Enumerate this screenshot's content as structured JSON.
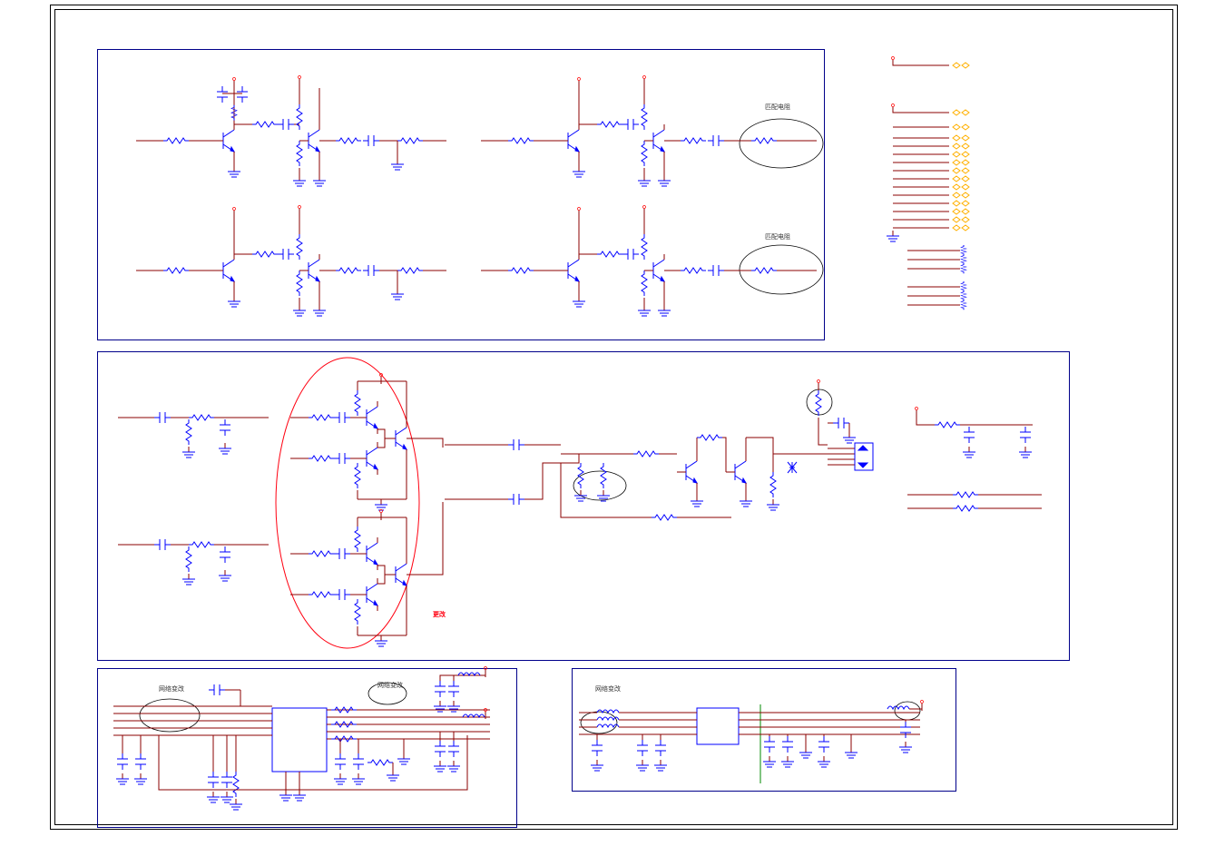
{
  "annotations": {
    "match_res_1": "匹配电阻",
    "match_res_2": "匹配电阻",
    "change": "更改",
    "net_change_1": "网络变改",
    "net_change_2": "网络变改",
    "net_change_3": "网络变改"
  }
}
